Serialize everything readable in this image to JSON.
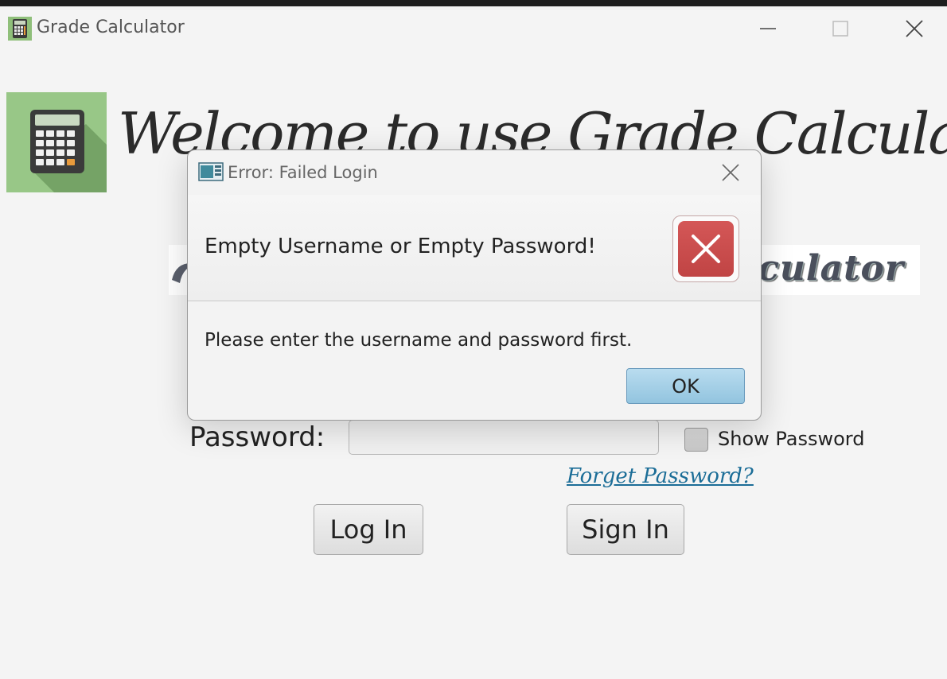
{
  "window": {
    "title": "Grade Calculator",
    "controls": [
      "minimize-icon",
      "maximize-icon",
      "close-icon"
    ]
  },
  "header": {
    "welcome": "Welcome to use Grade Calculator",
    "banner_text": "Calculator"
  },
  "form": {
    "password_label": "Password:",
    "password_value": "",
    "show_password_label": "Show Password",
    "show_password_checked": false,
    "forget_link": "Forget Password?",
    "login_button": "Log In",
    "signin_button": "Sign In"
  },
  "dialog": {
    "title": "Error: Failed Login",
    "header": "Empty Username or Empty Password!",
    "content": "Please enter the username and password first.",
    "ok_button": "OK",
    "icon": "error-icon"
  },
  "colors": {
    "error_red": "#c84a4a",
    "ok_blue": "#a6d0e8",
    "link": "#1b6d97",
    "logo_green": "#8fbf7a"
  }
}
